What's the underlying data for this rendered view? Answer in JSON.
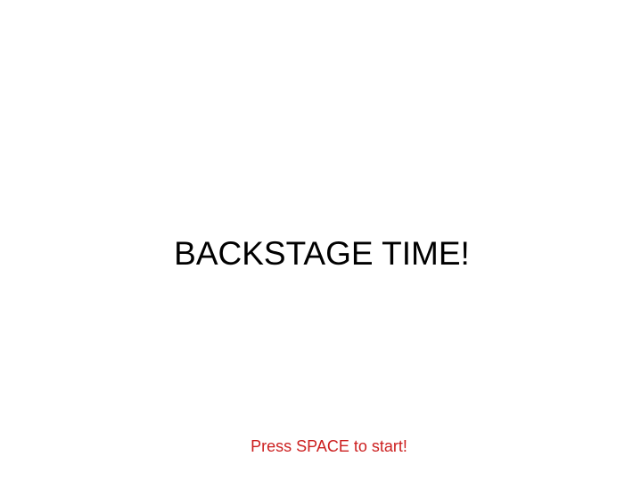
{
  "screen": {
    "title": "BACKSTAGE TIME!",
    "prompt": "Press SPACE to start!"
  },
  "colors": {
    "background": "#ffffff",
    "title": "#000000",
    "prompt": "#cc1f1f"
  }
}
